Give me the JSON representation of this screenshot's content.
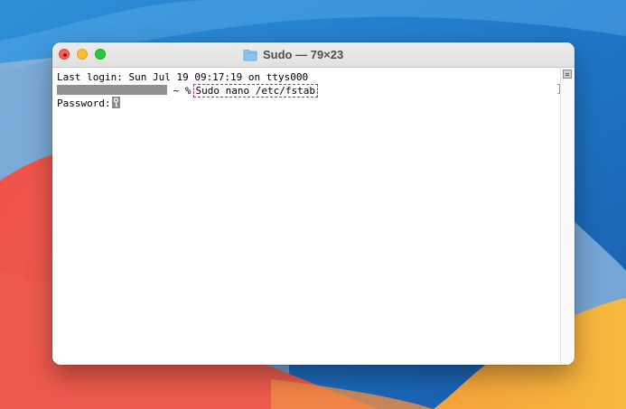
{
  "window": {
    "title": "Sudo — 79×23",
    "folder_icon": "folder-icon"
  },
  "terminal": {
    "last_login": "Last login: Sun Jul 19 09:17:19 on ttys000",
    "prompt_suffix": " ~ %",
    "command": "Sudo nano /etc/fstab",
    "password_label": "Password:"
  },
  "colors": {
    "close": "#fe5f57",
    "minimize": "#febc2e",
    "zoom": "#28c840",
    "highlight_border": "#d0303a",
    "redaction": "#909090"
  }
}
